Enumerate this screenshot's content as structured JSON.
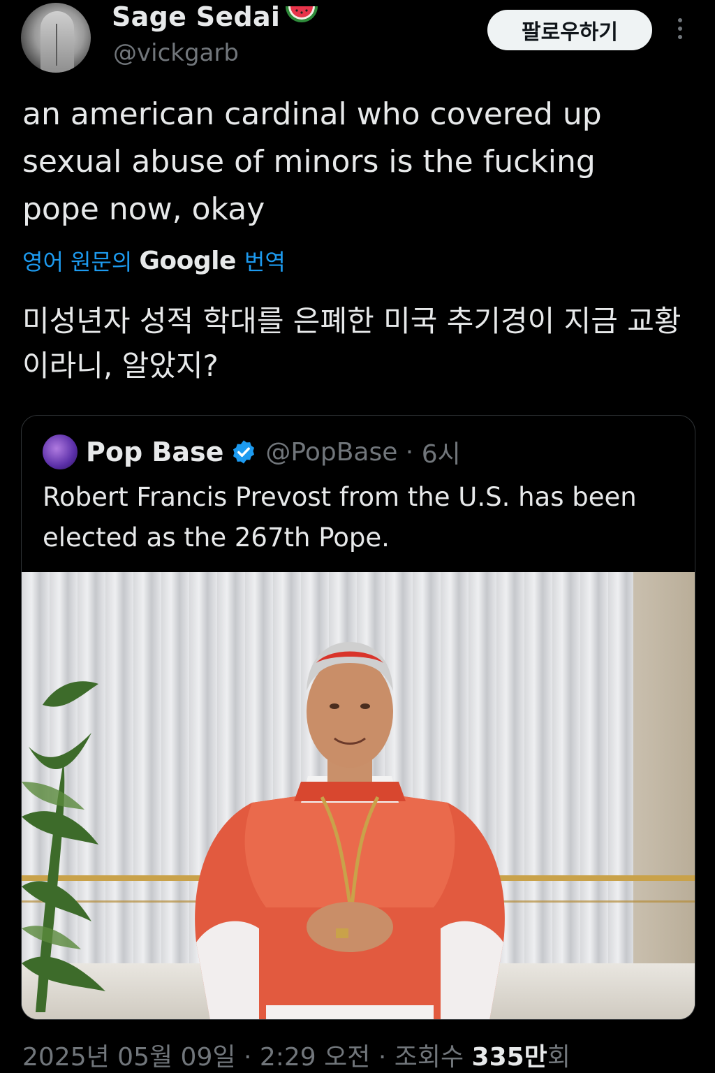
{
  "tweet": {
    "display_name": "Sage Sedai",
    "name_emoji_icon": "watermelon-icon",
    "handle": "@vickgarb",
    "follow_label": "팔로우하기",
    "text": "an american cardinal who covered up sexual abuse of minors is the fucking pope now, okay",
    "translate_prefix": "영어 원문의",
    "translate_brand": "Google",
    "translate_suffix": "번역",
    "translated_text": "미성년자 성적 학대를 은폐한 미국 추기경이 지금 교황이라니, 알았지?",
    "footer": {
      "date": "2025년 05월 09일",
      "time": "2:29 오전",
      "views_label": "조회수",
      "views_number": "335만",
      "views_suffix": "회"
    }
  },
  "quote": {
    "name": "Pop Base",
    "verified_icon": "verified-badge-icon",
    "handle": "@PopBase",
    "time": "6시",
    "text": "Robert Francis Prevost from the U.S. has been elected as the 267th Pope.",
    "image_icon": "cardinal-photo"
  },
  "colors": {
    "background": "#000000",
    "text": "#e7e9ea",
    "muted": "#71767b",
    "link": "#1d9bf0",
    "border": "#2f3336"
  }
}
